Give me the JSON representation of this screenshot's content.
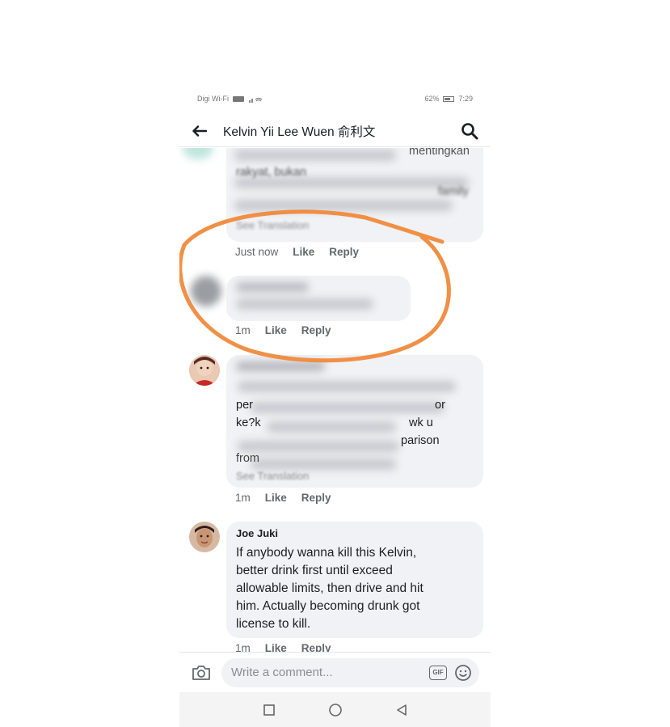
{
  "status_bar": {
    "carrier": "Digi Wi-Fi",
    "battery": "62%",
    "time": "7:29"
  },
  "header": {
    "title": "Kelvin Yii Lee Wuen 俞利文"
  },
  "comments": [
    {
      "fragments": [
        "mentingkan",
        "rakyat, bukan",
        "family"
      ],
      "see_translation": "See Translation",
      "time": "Just now",
      "like": "Like",
      "reply": "Reply"
    },
    {
      "time": "1m",
      "like": "Like",
      "reply": "Reply"
    },
    {
      "fragments": [
        "per",
        "or",
        "ke?k",
        "wk u",
        "parison",
        "from"
      ],
      "see_translation": "See Translation",
      "time": "1m",
      "like": "Like",
      "reply": "Reply"
    },
    {
      "author": "Joe Juki",
      "lines": [
        "If anybody wanna kill this Kelvin,",
        "better drink first until exceed",
        "allowable limits, then drive and hit",
        "him. Actually becoming drunk got",
        "license to kill."
      ],
      "time": "1m",
      "like": "Like",
      "reply": "Reply"
    }
  ],
  "composer": {
    "placeholder": "Write a comment...",
    "gif": "GIF"
  },
  "annotation_color": "#ef8a3c",
  "bubble_color": "#f0f2f5"
}
